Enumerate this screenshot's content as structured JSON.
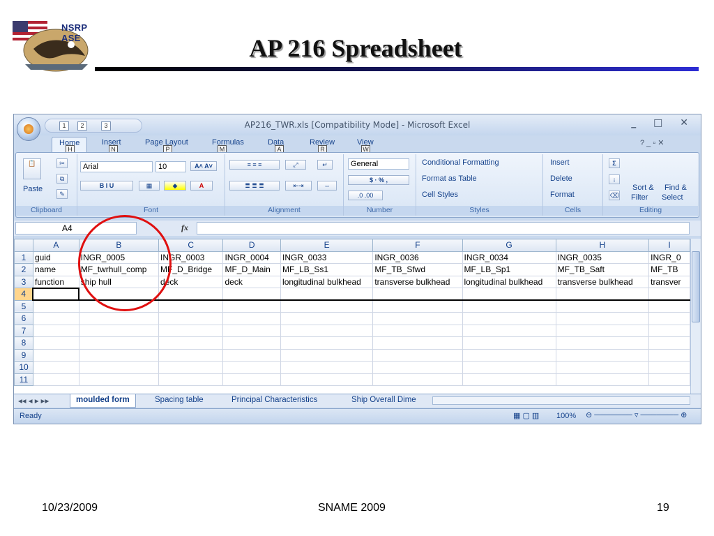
{
  "slide": {
    "logo_text": "NSRP ASE",
    "title": "AP 216 Spreadsheet",
    "footer_date": "10/23/2009",
    "footer_center": "SNAME 2009",
    "page_number": "19"
  },
  "excel": {
    "window_title": "AP216_TWR.xls  [Compatibility Mode] - Microsoft Excel",
    "office_key": "F",
    "qat_keys": [
      "1",
      "2",
      "3"
    ],
    "tabs": [
      {
        "label": "Home",
        "key": "H"
      },
      {
        "label": "Insert",
        "key": "N"
      },
      {
        "label": "Page Layout",
        "key": "P"
      },
      {
        "label": "Formulas",
        "key": "M"
      },
      {
        "label": "Data",
        "key": "A"
      },
      {
        "label": "Review",
        "key": "R"
      },
      {
        "label": "View",
        "key": "W"
      }
    ],
    "ribbon": {
      "clipboard": {
        "paste": "Paste",
        "label": "Clipboard"
      },
      "font": {
        "name": "Arial",
        "size": "10",
        "label": "Font"
      },
      "alignment": {
        "label": "Alignment"
      },
      "number": {
        "format": "General",
        "label": "Number"
      },
      "styles": {
        "conditional": "Conditional Formatting",
        "format_table": "Format as Table",
        "cell_styles": "Cell Styles",
        "label": "Styles"
      },
      "cells": {
        "insert": "Insert",
        "delete": "Delete",
        "format": "Format",
        "label": "Cells"
      },
      "editing": {
        "sort": "Sort &",
        "filter": "Filter",
        "find": "Find &",
        "select": "Select",
        "label": "Editing"
      }
    },
    "name_box": "A4",
    "fx": "fx",
    "columns": [
      "A",
      "B",
      "C",
      "D",
      "E",
      "F",
      "G",
      "H",
      "I"
    ],
    "rows": [
      [
        "guid",
        "INGR_0005",
        "INGR_0003",
        "INGR_0004",
        "INGR_0033",
        "INGR_0036",
        "INGR_0034",
        "INGR_0035",
        "INGR_0"
      ],
      [
        "name",
        "MF_twrhull_comp",
        "MF_D_Bridge",
        "MF_D_Main",
        "MF_LB_Ss1",
        "MF_TB_Sfwd",
        "MF_LB_Sp1",
        "MF_TB_Saft",
        "MF_TB"
      ],
      [
        "function",
        "ship hull",
        "deck",
        "deck",
        "longitudinal bulkhead",
        "transverse bulkhead",
        "longitudinal bulkhead",
        "transverse bulkhead",
        "transver"
      ]
    ],
    "row_numbers": [
      "1",
      "2",
      "3",
      "4",
      "5",
      "6",
      "7",
      "8",
      "9",
      "10",
      "11"
    ],
    "sheet_tabs": [
      "moulded form",
      "Spacing table",
      "Principal Characteristics",
      "Ship Overall Dime"
    ],
    "status": "Ready",
    "zoom": "100%"
  }
}
